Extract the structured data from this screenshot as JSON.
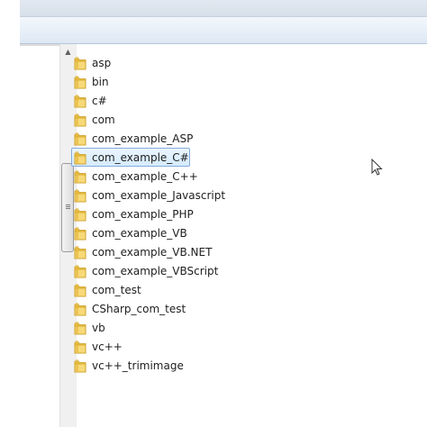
{
  "files": [
    {
      "name": "asp",
      "selected": false
    },
    {
      "name": "bin",
      "selected": false
    },
    {
      "name": "c#",
      "selected": false
    },
    {
      "name": "com",
      "selected": false
    },
    {
      "name": "com_example_ASP",
      "selected": false
    },
    {
      "name": "com_example_C#",
      "selected": true
    },
    {
      "name": "com_example_C++",
      "selected": false
    },
    {
      "name": "com_example_Javascript",
      "selected": false
    },
    {
      "name": "com_example_PHP",
      "selected": false
    },
    {
      "name": "com_example_VB",
      "selected": false
    },
    {
      "name": "com_example_VB.NET",
      "selected": false
    },
    {
      "name": "com_example_VBScript",
      "selected": false
    },
    {
      "name": "com_test",
      "selected": false
    },
    {
      "name": "CSharp_com_test",
      "selected": false
    },
    {
      "name": "vb",
      "selected": false
    },
    {
      "name": "vc++",
      "selected": false
    },
    {
      "name": "vc++_trimimage",
      "selected": false
    }
  ],
  "icons": {
    "folder": "folder-icon",
    "scroll_up": "scroll-up-arrow-icon",
    "cursor": "mouse-pointer-icon"
  },
  "colors": {
    "selection_fill": "#d5ebfd",
    "selection_border": "#84acdd",
    "folder_yellow": "#f2c94c"
  }
}
